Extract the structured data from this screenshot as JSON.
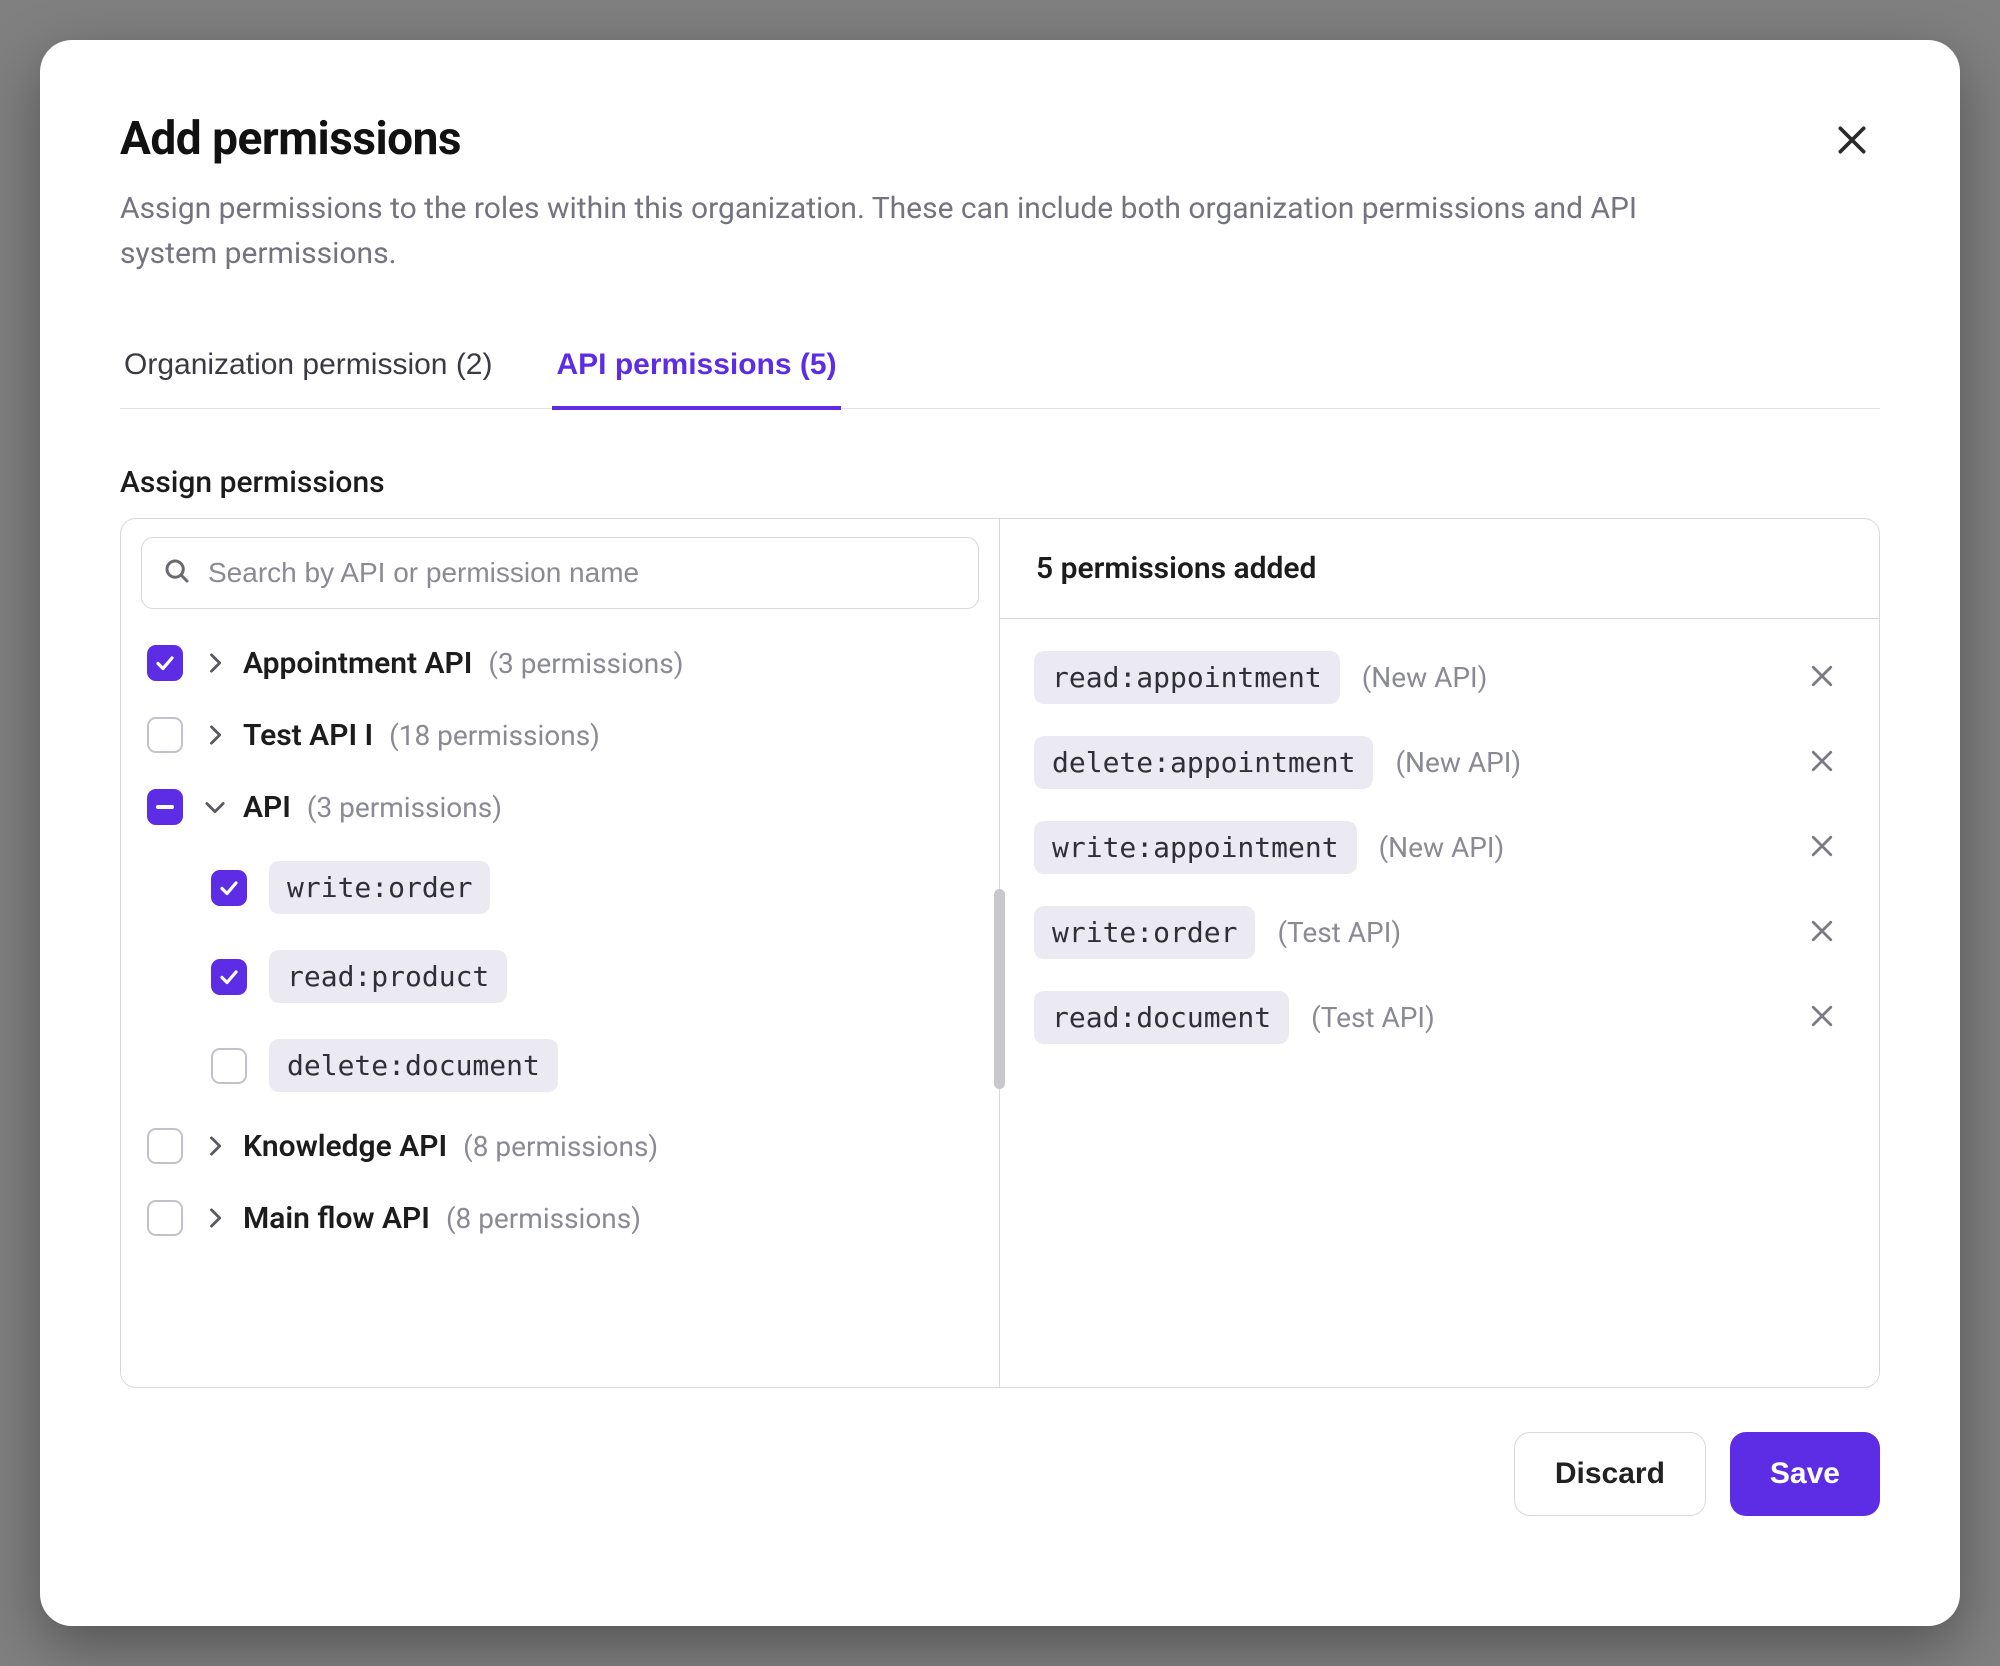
{
  "modal": {
    "title": "Add permissions",
    "subtitle": "Assign permissions to the roles within this organization. These can include both organization permissions and API system permissions."
  },
  "tabs": [
    {
      "label": "Organization permission (2)",
      "active": false
    },
    {
      "label": "API permissions (5)",
      "active": true
    }
  ],
  "section_label": "Assign permissions",
  "search": {
    "placeholder": "Search by API or permission name"
  },
  "tree": [
    {
      "name": "Appointment API",
      "count": "(3 permissions)",
      "state": "checked",
      "expanded": false
    },
    {
      "name": "Test API I",
      "count": "(18 permissions)",
      "state": "unchecked",
      "expanded": false
    },
    {
      "name": "API",
      "count": "(3 permissions)",
      "state": "indeterminate",
      "expanded": true,
      "children": [
        {
          "perm": "write:order",
          "state": "checked"
        },
        {
          "perm": "read:product",
          "state": "checked"
        },
        {
          "perm": "delete:document",
          "state": "unchecked"
        }
      ]
    },
    {
      "name": "Knowledge API",
      "count": "(8 permissions)",
      "state": "unchecked",
      "expanded": false
    },
    {
      "name": "Main flow API",
      "count": "(8 permissions)",
      "state": "unchecked",
      "expanded": false
    }
  ],
  "selected": {
    "header": "5 permissions added",
    "items": [
      {
        "perm": "read:appointment",
        "source": "(New API)"
      },
      {
        "perm": "delete:appointment",
        "source": "(New API)"
      },
      {
        "perm": "write:appointment",
        "source": "(New API)"
      },
      {
        "perm": "write:order",
        "source": "(Test API)"
      },
      {
        "perm": "read:document",
        "source": "(Test API)"
      }
    ]
  },
  "footer": {
    "discard": "Discard",
    "save": "Save"
  }
}
